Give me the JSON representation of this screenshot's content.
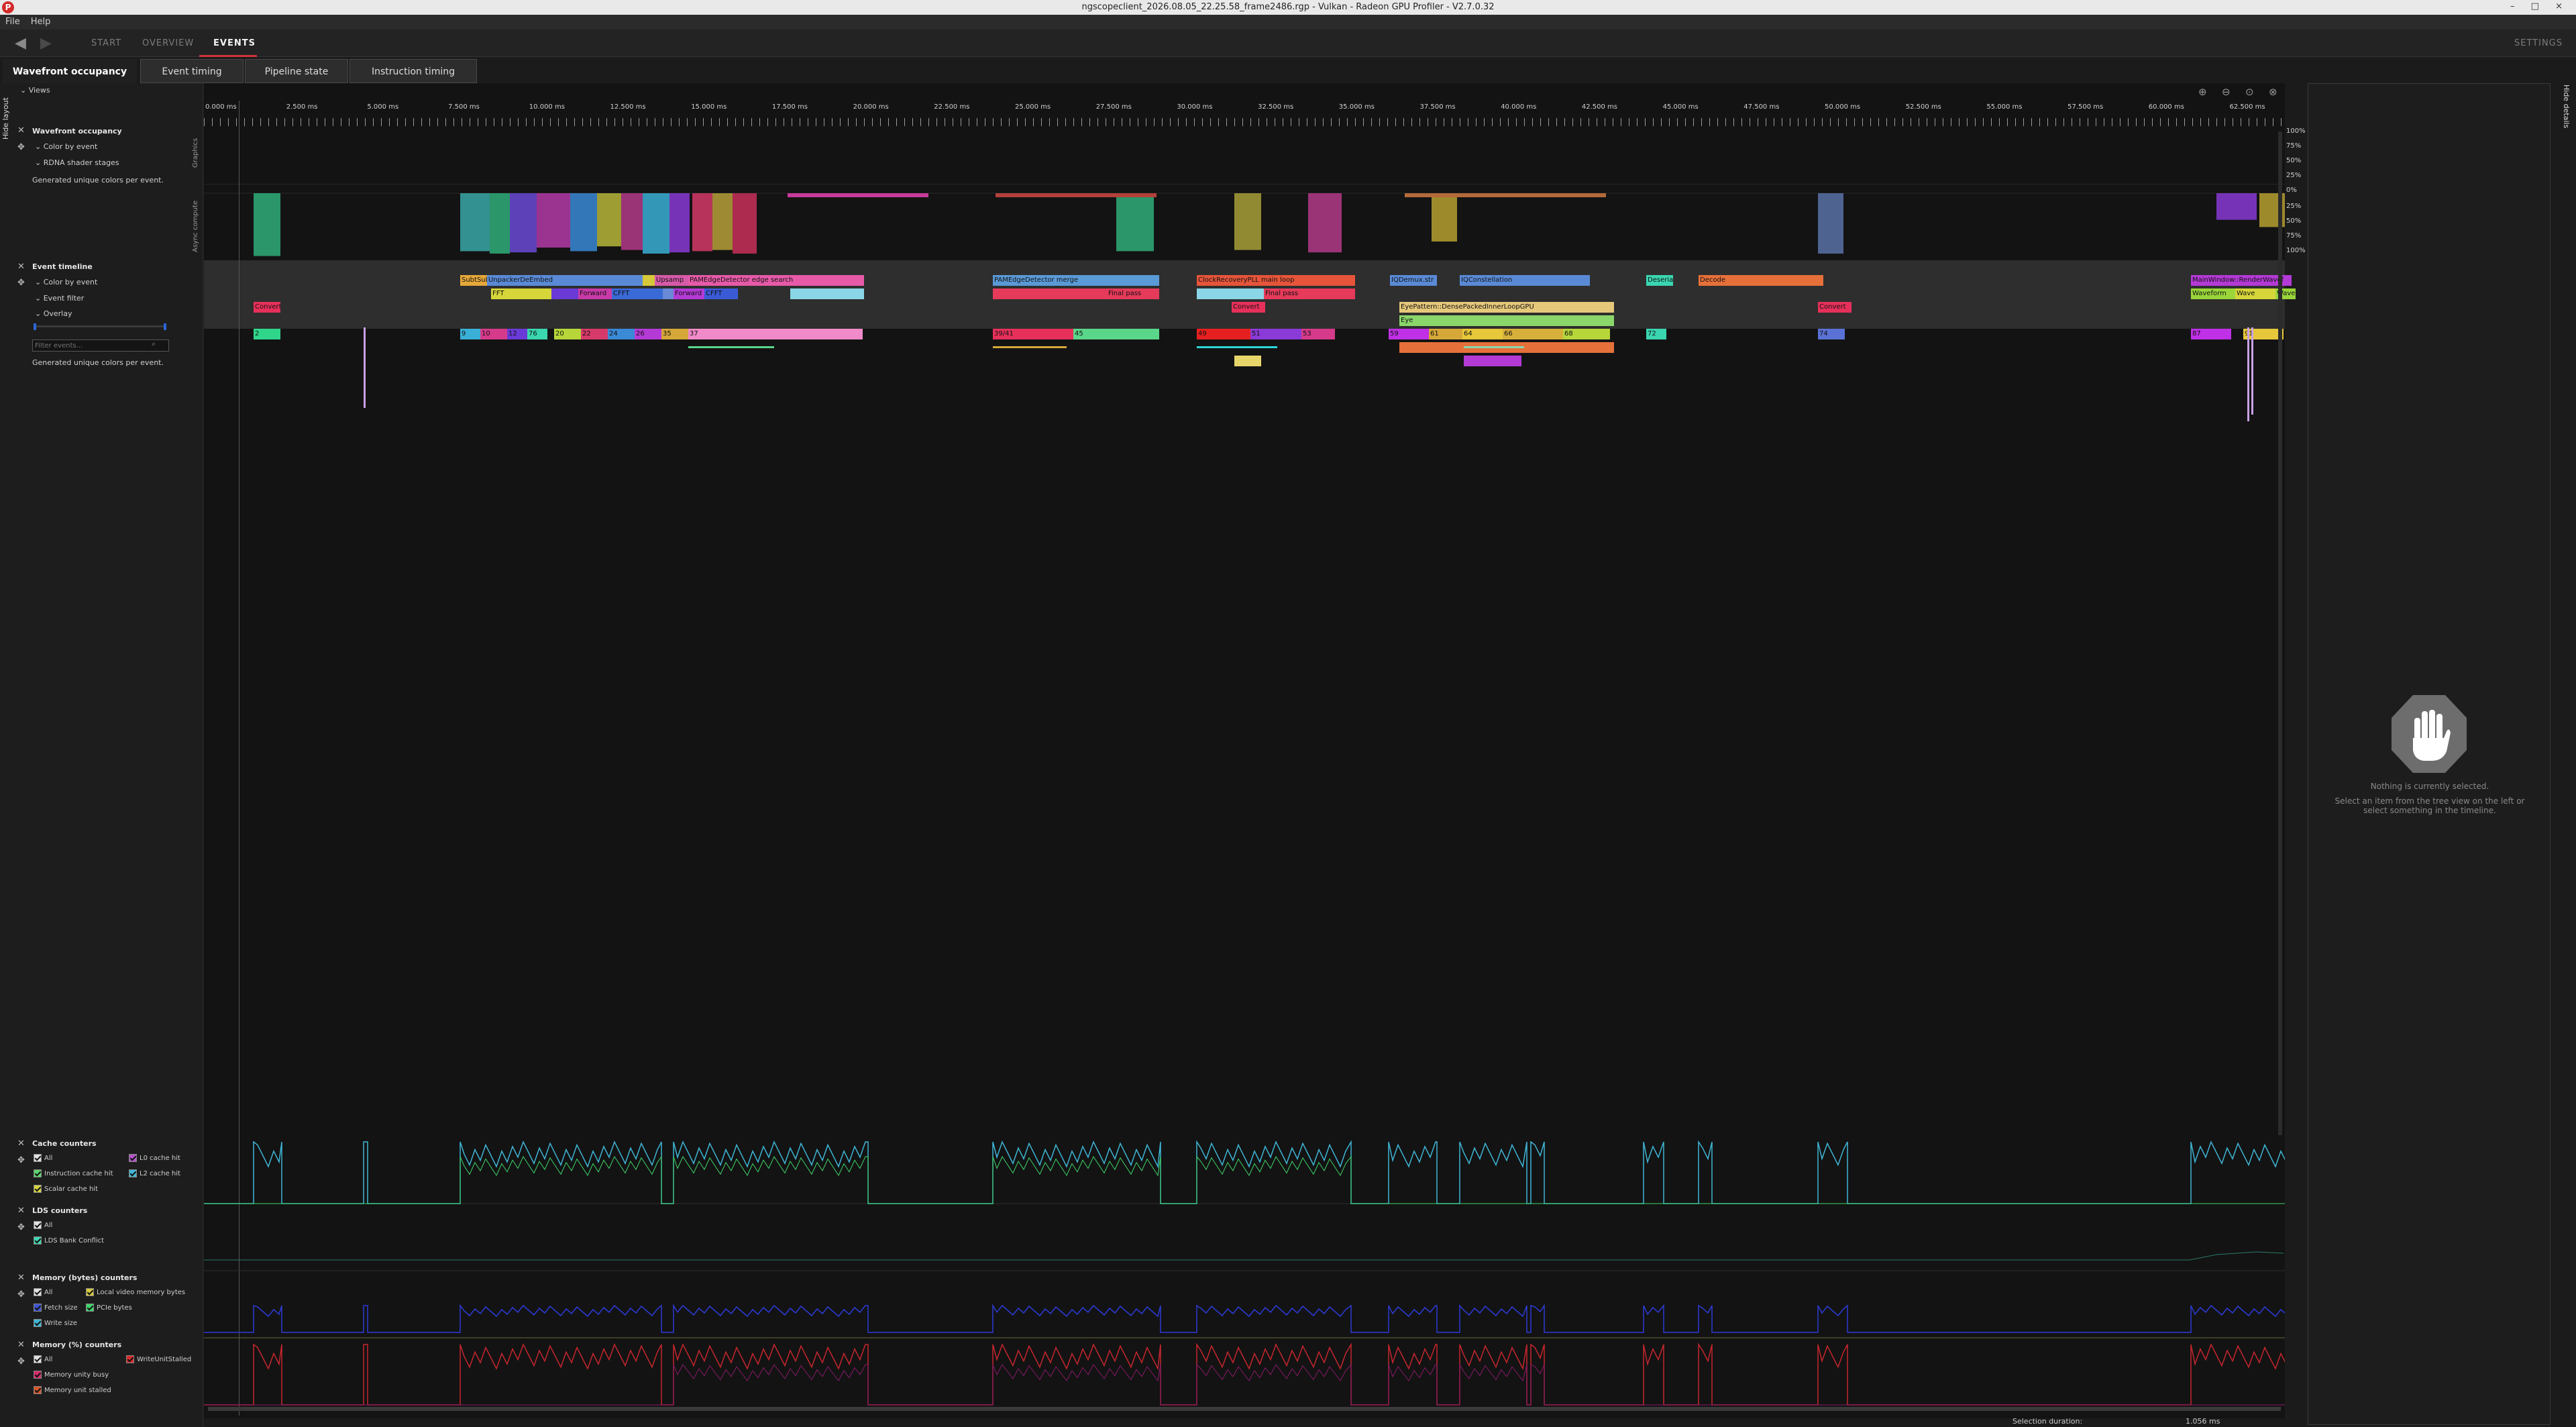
{
  "window": {
    "title": "ngscopeclient_2026.08.05_22.25.58_frame2486.rgp - Vulkan - Radeon GPU Profiler - V2.7.0.32",
    "app_icon": "P",
    "controls": "– □ ×"
  },
  "menu": {
    "items": [
      "File",
      "Help"
    ]
  },
  "nav": {
    "back": "◀",
    "forward": "▶",
    "tabs": [
      {
        "label": "START"
      },
      {
        "label": "OVERVIEW"
      },
      {
        "label": "EVENTS"
      }
    ],
    "settings": "SETTINGS"
  },
  "subtabs": [
    "Wavefront occupancy",
    "Event timing",
    "Pipeline state",
    "Instruction timing"
  ],
  "sidebar": {
    "hide_layout": "Hide layout",
    "views_label": "Views",
    "wavefront": {
      "title": "Wavefront occupancy",
      "opt1": "Color by event",
      "opt2": "RDNA shader stages",
      "note": "Generated unique colors per event."
    },
    "event_timeline": {
      "title": "Event timeline",
      "opt1": "Color by event",
      "opt2": "Event filter",
      "opt3": "Overlay",
      "filter_placeholder": "Filter events...",
      "note": "Generated unique colors per event."
    },
    "cache": {
      "title": "Cache counters",
      "all": "All",
      "l0": "L0 cache hit",
      "icache": "Instruction cache hit",
      "l2": "L2 cache hit",
      "scalar": "Scalar cache hit"
    },
    "lds": {
      "title": "LDS counters",
      "all": "All",
      "bank": "LDS Bank Conflict"
    },
    "mem_bytes": {
      "title": "Memory (bytes) counters",
      "all": "All",
      "local": "Local video memory bytes",
      "fetch": "Fetch size",
      "pcie": "PCIe bytes",
      "write": "Write size"
    },
    "mem_pct": {
      "title": "Memory (%) counters",
      "all": "All",
      "wus": "WriteUnitStalled",
      "busy": "Memory unity busy",
      "stalled": "Memory unit stalled"
    }
  },
  "ruler": {
    "ticks": [
      "0.000 ms",
      "2.500 ms",
      "5.000 ms",
      "7.500 ms",
      "10.000 ms",
      "12.500 ms",
      "15.000 ms",
      "17.500 ms",
      "20.000 ms",
      "22.500 ms",
      "25.000 ms",
      "27.500 ms",
      "30.000 ms",
      "32.500 ms",
      "35.000 ms",
      "37.500 ms",
      "40.000 ms",
      "42.500 ms",
      "45.000 ms",
      "47.500 ms",
      "50.000 ms",
      "52.500 ms",
      "55.000 ms",
      "57.500 ms",
      "60.000 ms",
      "62.500 ms"
    ]
  },
  "lanes": {
    "graphics_label": "Graphics",
    "async_label": "Async compute",
    "pct_graphics": [
      "100%",
      "75%",
      "50%",
      "25%",
      "0%"
    ],
    "pct_async": [
      "25%",
      "50%",
      "75%",
      "100%"
    ]
  },
  "events": {
    "row1": [
      "SubtSub",
      "UnpackerDeEmbed",
      "Upsamp",
      "PAMEdgeDetector edge search",
      "PAMEdgeDetector merge",
      "ClockRecoveryPLL main loop",
      "IQDemux.str",
      "IQConstellation",
      "Deserial",
      "Decode",
      "MainWindow::RenderWavef"
    ],
    "row2": [
      "FFT",
      "Forward",
      "CFFT",
      "Forward",
      "CFFT",
      "Second",
      "Final pass",
      "Final pass",
      "Waveform",
      "Wave",
      "Wave"
    ],
    "row3": [
      "Convert",
      "Convert",
      "EyePattern::DensePackedInnerLoopGPU",
      "Convert"
    ],
    "row4": [
      "Eye"
    ],
    "markers": [
      "2",
      "9",
      "10",
      "12",
      "76",
      "20",
      "22",
      "24",
      "26",
      "35",
      "37",
      "39/41",
      "45",
      "49",
      "51",
      "53",
      "59",
      "61",
      "64",
      "66",
      "68",
      "72",
      "74",
      "87",
      "91",
      "96",
      "98",
      "110",
      "118",
      "119",
      "175"
    ]
  },
  "details": {
    "hide_details": "Hide details",
    "msg1": "Nothing is currently selected.",
    "msg2": "Select an item from the tree view on the left or select something in the timeline."
  },
  "status": {
    "label": "Selection duration:",
    "value": "1.056 ms"
  },
  "colors": {
    "accent": "#d0333a",
    "graphics_green": "#3aa878",
    "cache_blue": "#3fb6d6",
    "mem_blue": "#2c3bd6",
    "mem_red": "#c6262e"
  }
}
